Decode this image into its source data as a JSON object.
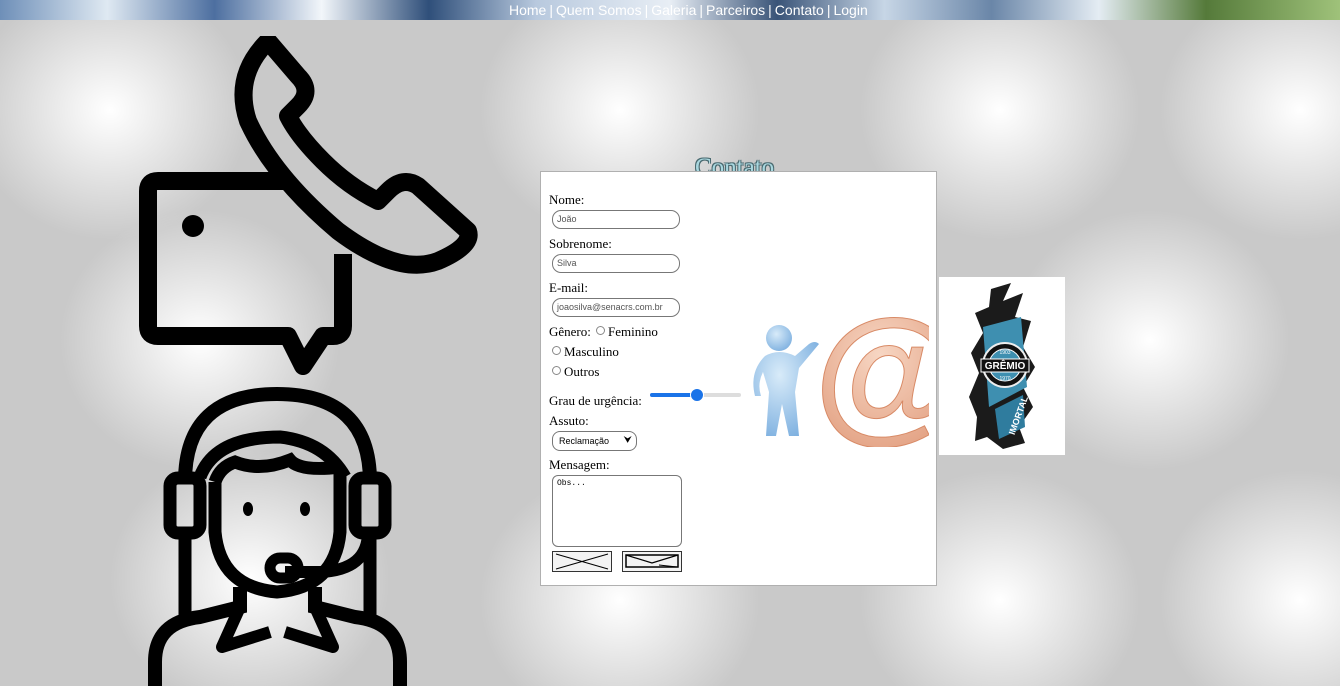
{
  "nav": {
    "items": [
      "Home",
      "Quem Somos",
      "Galeria",
      "Parceiros",
      "Contato",
      "Login"
    ],
    "separator": "|"
  },
  "form": {
    "title": "Contato",
    "nome_label": "Nome:",
    "nome_value": "João",
    "sobrenome_label": "Sobrenome:",
    "sobrenome_value": "Silva",
    "email_label": "E-mail:",
    "email_value": "joaosilva@senacrs.com.br",
    "genero_label": "Gênero:",
    "genero_options": [
      "Feminino",
      "Masculino",
      "Outros"
    ],
    "urgencia_label": "Grau de urgência:",
    "urgencia_value": 0.5,
    "assunto_label": "Assuto:",
    "assunto_selected": "Reclamação",
    "mensagem_label": "Mensagem:",
    "mensagem_value": "Obs..."
  },
  "gremio": {
    "name": "GRÊMIO",
    "motto": "IMORTAL",
    "year_left": "1903",
    "year_right": "1970"
  },
  "colors": {
    "slider_accent": "#1a73e8",
    "title_fill": "#a9d7df",
    "at_color": "#e9a98a",
    "figure_color": "#9ec3e6"
  }
}
